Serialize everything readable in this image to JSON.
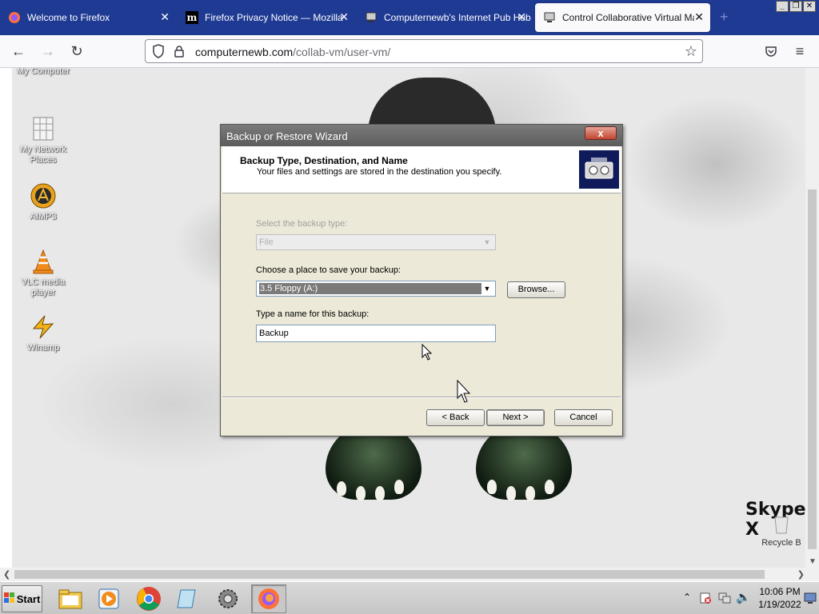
{
  "browser": {
    "tabs": [
      {
        "title": "Welcome to Firefox",
        "icon": "firefox-icon",
        "active": false
      },
      {
        "title": "Firefox Privacy Notice — Mozilla",
        "icon": "mozilla-icon",
        "active": false
      },
      {
        "title": "Computernewb's Internet Pub Hub",
        "icon": "computernewb-icon",
        "active": false
      },
      {
        "title": "Control Collaborative Virtual Machi",
        "icon": "computernewb-icon",
        "active": true
      }
    ],
    "new_tab": "+",
    "url_domain": "computernewb.com",
    "url_path": "/collab-vm/user-vm/"
  },
  "desktop": {
    "icons": [
      {
        "label": "My Computer"
      },
      {
        "label": "My Network Places"
      },
      {
        "label": "AIMP3"
      },
      {
        "label": "VLC media player"
      },
      {
        "label": "Winamp"
      },
      {
        "label": "Recycle B"
      }
    ],
    "wallpaper_text": "Skype X"
  },
  "wizard": {
    "window_title": "Backup or Restore Wizard",
    "close_label": "x",
    "header_title": "Backup Type, Destination, and Name",
    "header_subtitle": "Your files and settings are stored in the destination you specify.",
    "backup_type_label": "Select the backup type:",
    "backup_type_value": "File",
    "destination_label": "Choose a place to save your backup:",
    "destination_value": "3.5 Floppy (A:)",
    "browse_label": "Browse...",
    "name_label": "Type a name for this backup:",
    "name_value": "Backup",
    "back_label": "< Back",
    "next_label": "Next >",
    "cancel_label": "Cancel"
  },
  "taskbar": {
    "start_label": "Start",
    "clock_time": "10:06 PM",
    "clock_date": "1/19/2022"
  },
  "colors": {
    "tabstrip": "#1f3a93",
    "dialog_title": "#6b6b6b",
    "dialog_body": "#ece9d8"
  }
}
